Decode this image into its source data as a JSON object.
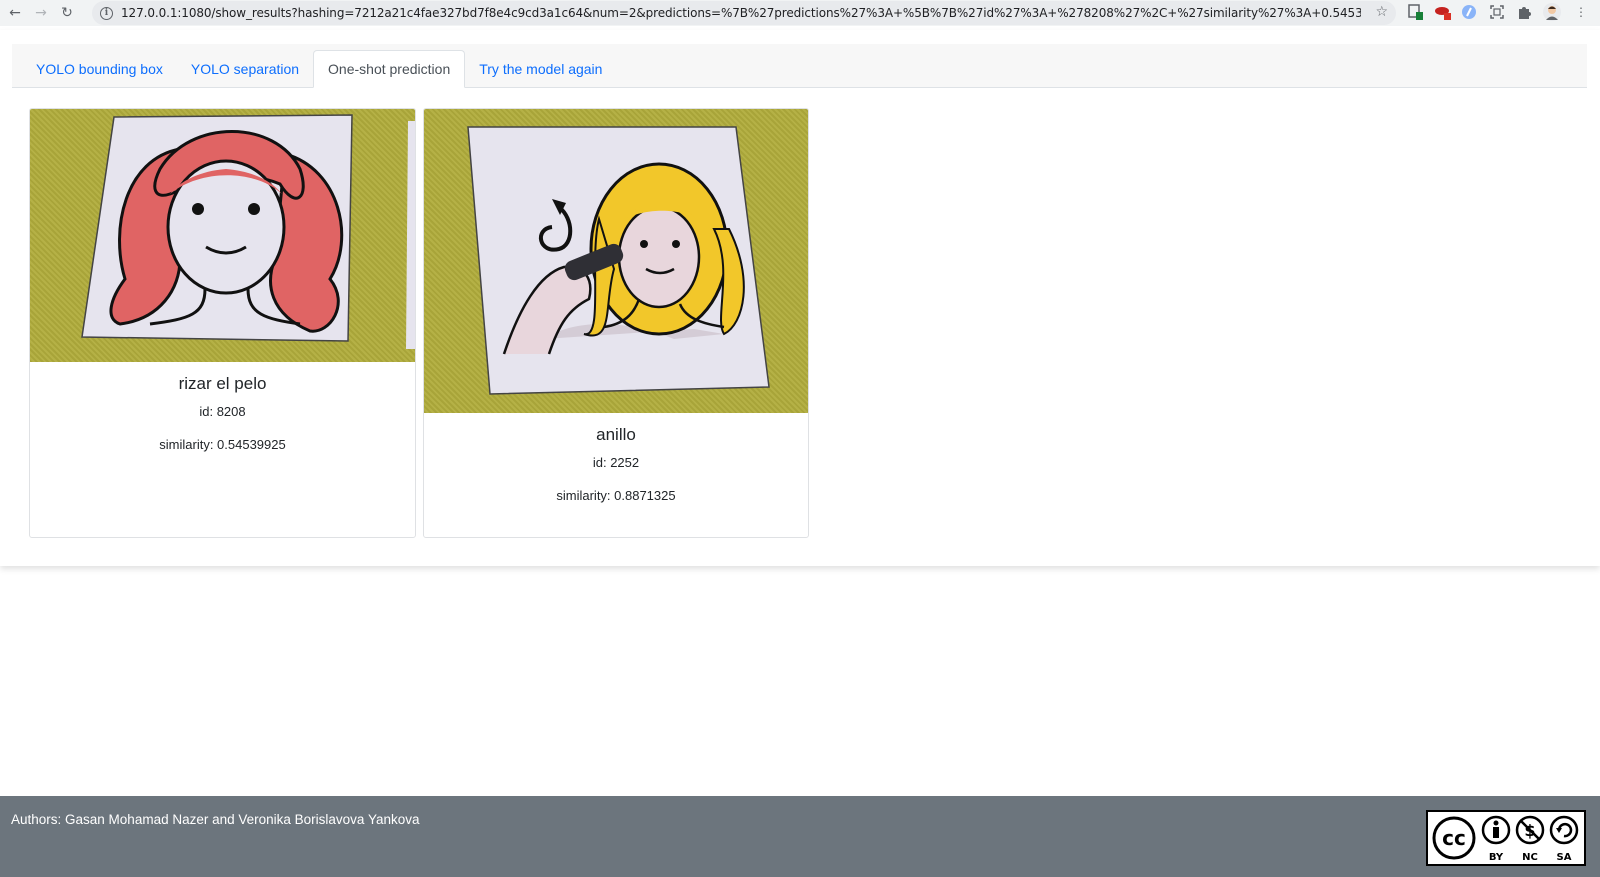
{
  "browser": {
    "url": "127.0.0.1:1080/show_results?hashing=7212a21c4fae327bd7f8e4c9cd3a1c64&num=2&predictions=%7B%27predictions%27%3A+%5B%7B%27id%27%3A+%278208%27%2C+%27similarity%27%3A+0.54539925%2C+%27p..."
  },
  "tabs": [
    {
      "label": "YOLO bounding box"
    },
    {
      "label": "YOLO separation"
    },
    {
      "label": "One-shot prediction"
    },
    {
      "label": "Try the model again"
    }
  ],
  "active_tab": "One-shot prediction",
  "predictions": [
    {
      "title": "rizar el pelo",
      "id_text": "id: 8208",
      "similarity_text": "similarity: 0.54539925"
    },
    {
      "title": "anillo",
      "id_text": "id: 2252",
      "similarity_text": "similarity: 0.8871325"
    }
  ],
  "footer": {
    "authors": "Authors: Gasan Mohamad Nazer and Veronika Borislavova Yankova",
    "license_labels": [
      "BY",
      "NC",
      "SA"
    ],
    "license_icon": "cc"
  },
  "colors": {
    "tab_link": "#0d6efd",
    "footer_bg": "#6c757d",
    "hair_red": "#e06464",
    "hair_yellow": "#f2c72a"
  }
}
